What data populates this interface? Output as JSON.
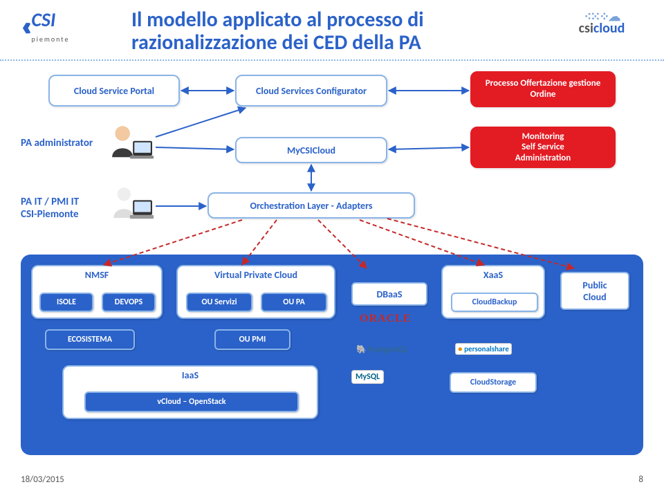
{
  "header": {
    "logo_text": "CSI",
    "logo_sub": "piemonte",
    "title": "Il modello applicato al processo di razionalizzazione dei CED della PA",
    "cloud_logo": "csicloud"
  },
  "row1": {
    "portal": "Cloud Service Portal",
    "configurator": "Cloud Services Configurator",
    "offerta": "Processo Offertazione gestione Ordine"
  },
  "row2": {
    "pa_admin": "PA administrator",
    "mycsicloud": "MyCSICloud",
    "monitoring": "Monitoring\nSelf Service\nAdministration"
  },
  "row3": {
    "pa_it": "PA IT / PMI IT\nCSI-Piemonte",
    "orchestration": "Orchestration Layer - Adapters"
  },
  "panel": {
    "nmsf": {
      "title": "NMSF",
      "isole": "ISOLE",
      "devops": "DEVOPS",
      "eco": "ECOSISTEMA"
    },
    "vpc": {
      "title": "Virtual Private Cloud",
      "ouservizi": "OU Servizi",
      "oupa": "OU PA",
      "oupmi": "OU PMI"
    },
    "iaas": {
      "title": "IaaS",
      "vcloud": "vCloud – OpenStack"
    },
    "dbaas": "DBaaS",
    "xaas": {
      "title": "XaaS",
      "backup": "CloudBackup",
      "storage": "CloudStorage"
    },
    "public": "Public\nCloud"
  },
  "vendors": {
    "oracle": "ORACLE",
    "postgres": "PostgreSQL",
    "mysql": "MySQL",
    "pshare": "personalshare"
  },
  "footer": {
    "date": "18/03/2015",
    "page": "8"
  }
}
